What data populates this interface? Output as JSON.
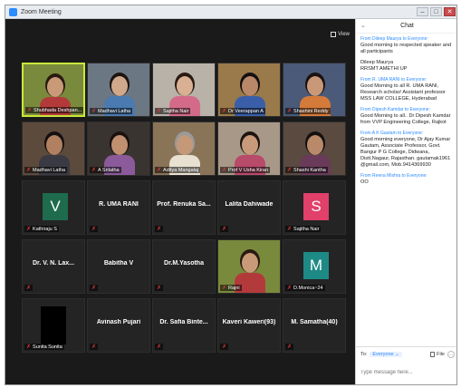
{
  "window": {
    "title": "Zoom Meeting"
  },
  "toolbar": {
    "view_label": "View"
  },
  "tiles": [
    {
      "name": "Shubhada Deshpan...",
      "kind": "video"
    },
    {
      "name": "Madhavi Latha",
      "kind": "video"
    },
    {
      "name": "Sajitha Nair",
      "kind": "video"
    },
    {
      "name": "Dr Veerappan A",
      "kind": "video"
    },
    {
      "name": "Shashini Reddy",
      "kind": "video"
    },
    {
      "name": "Madhavi Latha",
      "kind": "video"
    },
    {
      "name": "A Srilatha",
      "kind": "video"
    },
    {
      "name": "Aditya Mangalaj",
      "kind": "video"
    },
    {
      "name": "Prof V Usha Kiran",
      "kind": "video"
    },
    {
      "name": "Shashi Kantha",
      "kind": "video"
    },
    {
      "name": "Kathiraju S",
      "kind": "avatar",
      "letter": "V",
      "color": "#1e6b4e"
    },
    {
      "name": "R. UMA RANI",
      "kind": "name"
    },
    {
      "name": "Prof. Renuka Sa...",
      "kind": "name"
    },
    {
      "name": "Lalita Dahiwade",
      "kind": "name"
    },
    {
      "name": "Sajitha Nair",
      "kind": "avatar",
      "letter": "S",
      "color": "#e0406a"
    },
    {
      "name": "Dr. V. N. Lax...",
      "kind": "name"
    },
    {
      "name": "Babitha V",
      "kind": "name"
    },
    {
      "name": "Dr.M.Yasotha",
      "kind": "name"
    },
    {
      "name": "Rajni",
      "kind": "video"
    },
    {
      "name": "D.Monica~24",
      "kind": "avatar",
      "letter": "M",
      "color": "#1e8a86"
    },
    {
      "name": "Sunita Sunita",
      "kind": "black"
    },
    {
      "name": "Avinash Pujari",
      "kind": "name"
    },
    {
      "name": "Dr. Safia Binte...",
      "kind": "name"
    },
    {
      "name": "Kaveri Kaweri(93)",
      "kind": "name"
    },
    {
      "name": "M. Samatha(40)",
      "kind": "name"
    }
  ],
  "chat": {
    "title": "Chat",
    "messages": [
      {
        "from": "From Dileep Maurya to Everyone:",
        "text": "Good morning to respected speaker and all participants"
      },
      {
        "from": "",
        "text": "Dileep Maurya\nRRSMT AMETHI UP"
      },
      {
        "from": "From R. UMA RANI to Everyone:",
        "text": "Good Morning to all R. UMA RANI, Research scholar/ Assistant professor MSS LAW COLLEGE, Hyderabad"
      },
      {
        "from": "From Dipesh Kamdar to Everyone:",
        "text": "Good Morning to all.. Dr Dipesh Kamdar from VVP Engineering College, Rajkot"
      },
      {
        "from": "From A K Gautam to Everyone:",
        "text": "Good morning everyone, Dr Ajay Kumar Gautam, Associate Professor, Govt. Bangur P G College, Didwana, Distt.Nagaur, Rajasthan. gautamak1961 @gmail.com, Mob.9414369930"
      },
      {
        "from": "From Reena Mishra to Everyone:",
        "text": "OO"
      }
    ],
    "to_label": "To:",
    "to_value": "Everyone",
    "file_label": "File",
    "input_placeholder": "Type message here..."
  }
}
